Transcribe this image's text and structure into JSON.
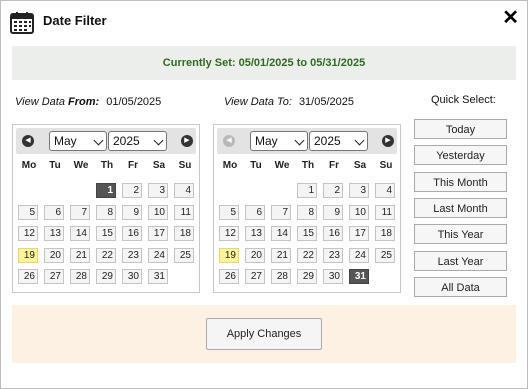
{
  "dialog": {
    "title": "Date Filter",
    "close_label": "✕",
    "banner": "Currently Set: 05/01/2025 to 05/31/2025"
  },
  "from": {
    "label_prefix": "View Data ",
    "label_bold": "From:",
    "value": "01/05/2025",
    "month": "May",
    "year": "2025",
    "prev_icon": "chevron-left-icon",
    "next_icon": "chevron-right-icon"
  },
  "to": {
    "label_prefix": "View Data To:",
    "value": "31/05/2025",
    "month": "May",
    "year": "2025"
  },
  "weekdays": [
    "Mo",
    "Tu",
    "We",
    "Th",
    "Fr",
    "Sa",
    "Su"
  ],
  "calendar": {
    "first_weekday_index": 3,
    "days_in_month": 31,
    "today": 19,
    "from_selected": 1,
    "to_selected": 31
  },
  "quick_select": {
    "label": "Quick Select:",
    "buttons": [
      "Today",
      "Yesterday",
      "This Month",
      "Last Month",
      "This Year",
      "Last Year",
      "All Data"
    ]
  },
  "footer": {
    "apply_label": "Apply Changes"
  },
  "colors": {
    "banner_text": "#2e6b1f",
    "today_highlight": "#fdf49a",
    "selected_day": "#555555",
    "footer_bg": "#fdf1e4"
  }
}
